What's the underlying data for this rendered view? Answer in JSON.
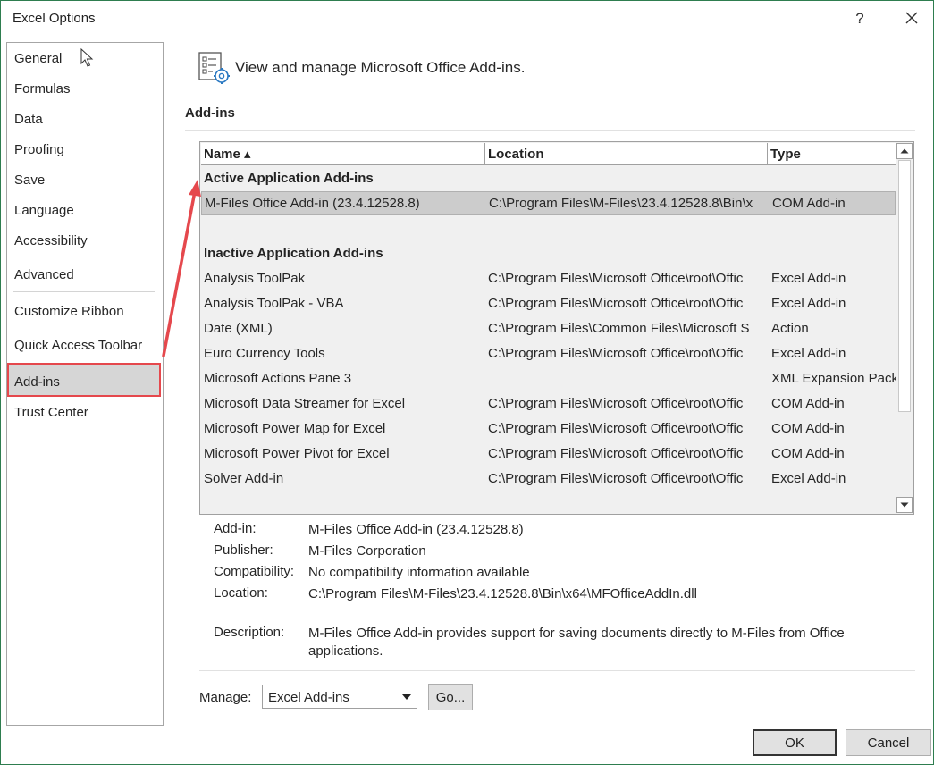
{
  "window": {
    "title": "Excel Options",
    "help_label": "?"
  },
  "sidebar": {
    "items": [
      {
        "label": "General"
      },
      {
        "label": "Formulas"
      },
      {
        "label": "Data"
      },
      {
        "label": "Proofing"
      },
      {
        "label": "Save"
      },
      {
        "label": "Language"
      },
      {
        "label": "Accessibility"
      },
      {
        "label": "Advanced"
      },
      {
        "label": "Customize Ribbon"
      },
      {
        "label": "Quick Access Toolbar"
      },
      {
        "label": "Add-ins"
      },
      {
        "label": "Trust Center"
      }
    ],
    "active": "Add-ins"
  },
  "header": {
    "text": "View and manage Microsoft Office Add-ins."
  },
  "section": {
    "title": "Add-ins"
  },
  "table": {
    "columns": {
      "name": "Name ▴",
      "location": "Location",
      "type": "Type"
    },
    "groups": [
      {
        "label": "Active Application Add-ins",
        "rows": [
          {
            "name": "M-Files Office Add-in (23.4.12528.8)",
            "location": "C:\\Program Files\\M-Files\\23.4.12528.8\\Bin\\x",
            "type": "COM Add-in",
            "selected": true
          }
        ]
      },
      {
        "label": "Inactive Application Add-ins",
        "rows": [
          {
            "name": "Analysis ToolPak",
            "location": "C:\\Program Files\\Microsoft Office\\root\\Offic",
            "type": "Excel Add-in"
          },
          {
            "name": "Analysis ToolPak - VBA",
            "location": "C:\\Program Files\\Microsoft Office\\root\\Offic",
            "type": "Excel Add-in"
          },
          {
            "name": "Date (XML)",
            "location": "C:\\Program Files\\Common Files\\Microsoft S",
            "type": "Action"
          },
          {
            "name": "Euro Currency Tools",
            "location": "C:\\Program Files\\Microsoft Office\\root\\Offic",
            "type": "Excel Add-in"
          },
          {
            "name": "Microsoft Actions Pane 3",
            "location": "",
            "type": "XML Expansion Pack"
          },
          {
            "name": "Microsoft Data Streamer for Excel",
            "location": "C:\\Program Files\\Microsoft Office\\root\\Offic",
            "type": "COM Add-in"
          },
          {
            "name": "Microsoft Power Map for Excel",
            "location": "C:\\Program Files\\Microsoft Office\\root\\Offic",
            "type": "COM Add-in"
          },
          {
            "name": "Microsoft Power Pivot for Excel",
            "location": "C:\\Program Files\\Microsoft Office\\root\\Offic",
            "type": "COM Add-in"
          },
          {
            "name": "Solver Add-in",
            "location": "C:\\Program Files\\Microsoft Office\\root\\Offic",
            "type": "Excel Add-in"
          }
        ]
      }
    ]
  },
  "details": {
    "addin_label": "Add-in:",
    "addin": "M-Files Office Add-in (23.4.12528.8)",
    "publisher_label": "Publisher:",
    "publisher": "M-Files Corporation",
    "compat_label": "Compatibility:",
    "compat": "No compatibility information available",
    "location_label": "Location:",
    "location": "C:\\Program Files\\M-Files\\23.4.12528.8\\Bin\\x64\\MFOfficeAddIn.dll",
    "description_label": "Description:",
    "description": "M-Files Office Add-in provides support for saving documents directly to M-Files from Office applications."
  },
  "manage": {
    "label": "Manage:",
    "selected": "Excel Add-ins",
    "go_label": "Go..."
  },
  "footer": {
    "ok_label": "OK",
    "cancel_label": "Cancel"
  },
  "colors": {
    "highlight_border": "#e5484d",
    "annotation_arrow": "#e5484d",
    "selected_row": "#cccccc"
  }
}
